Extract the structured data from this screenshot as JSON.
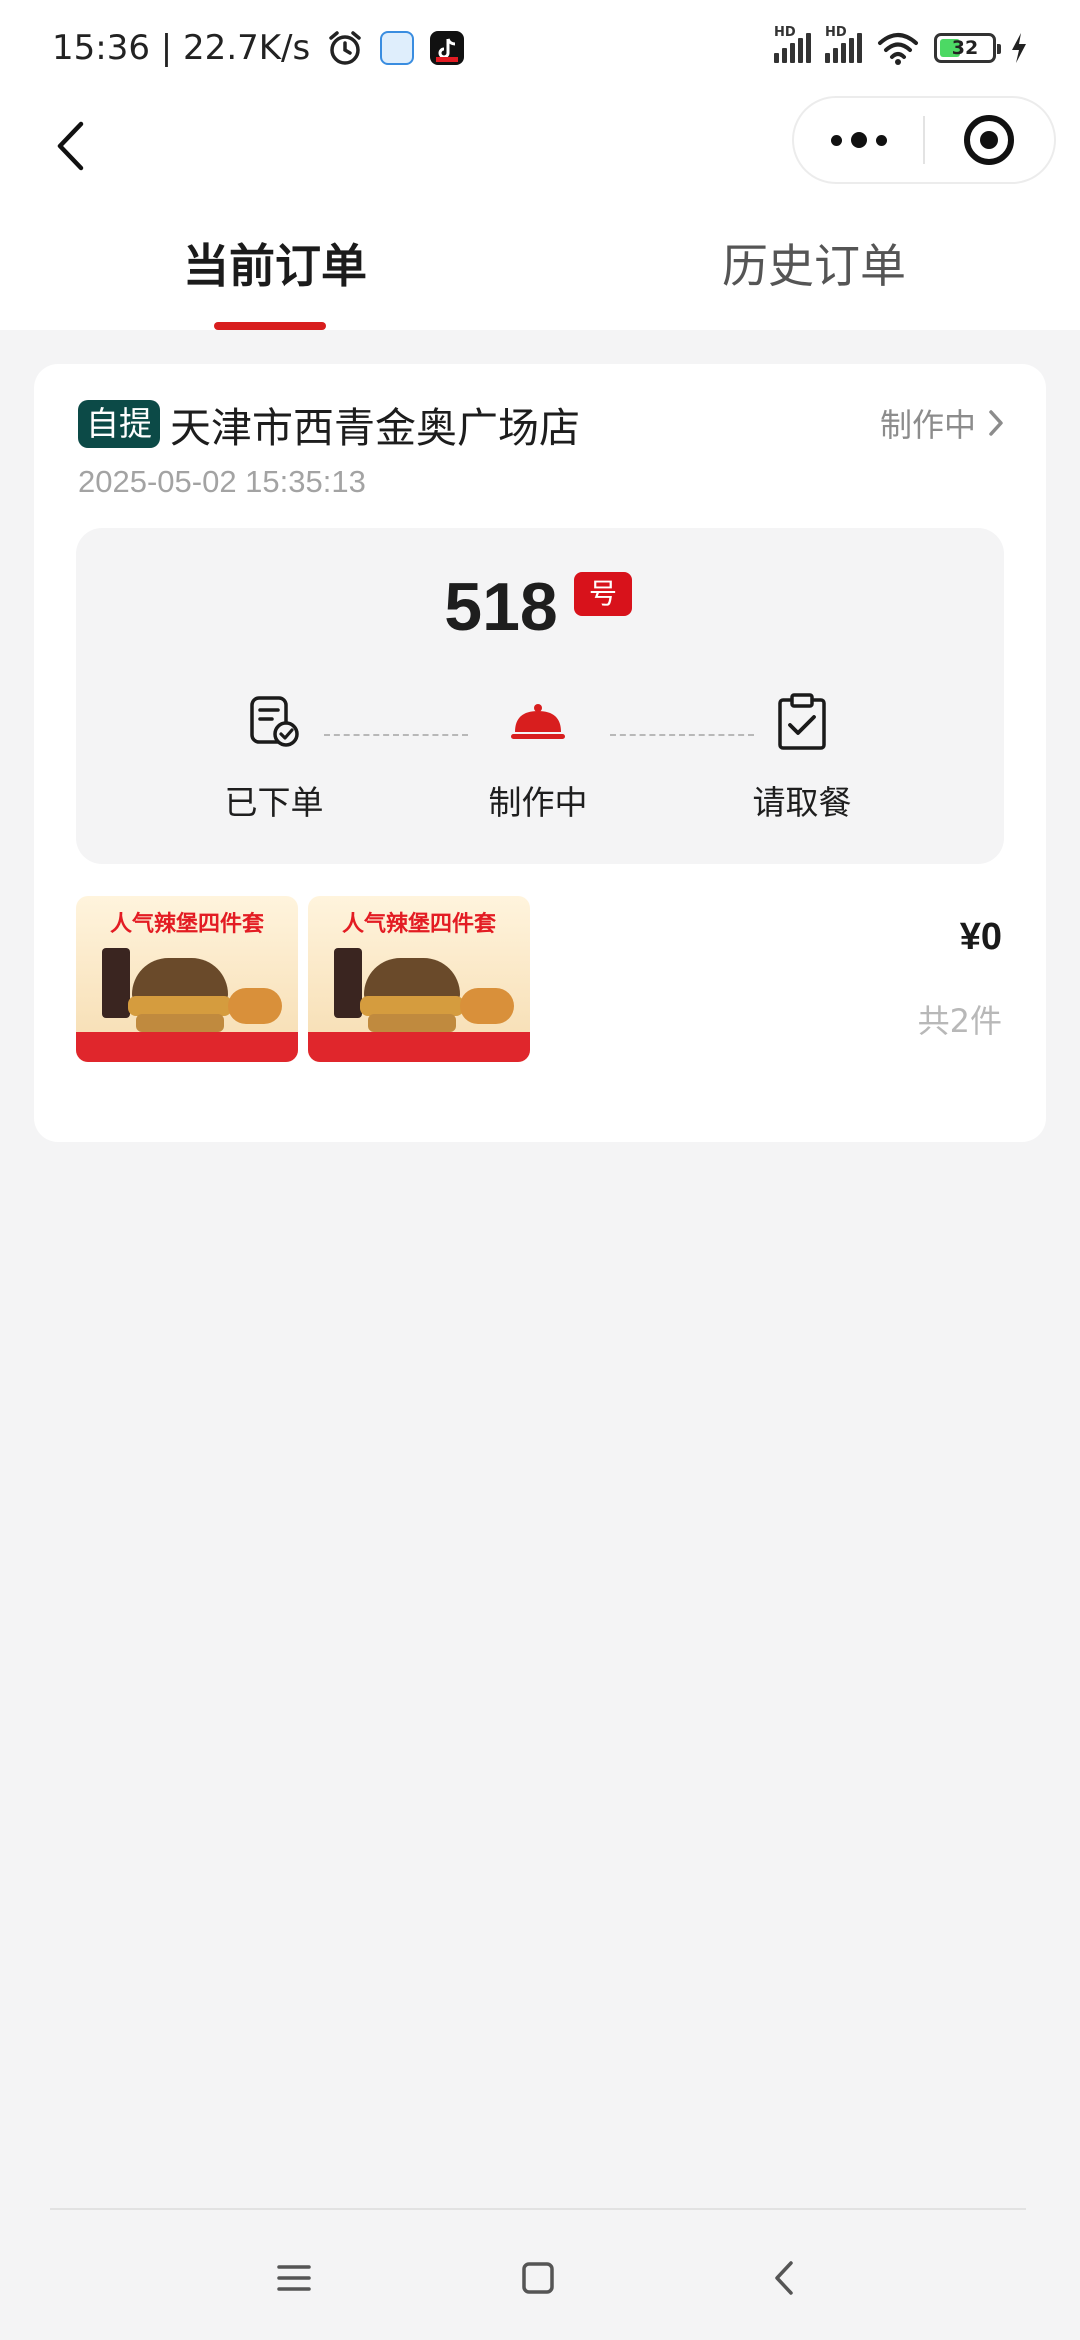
{
  "status_bar": {
    "time_speed": "15:36 | 22.7K/s",
    "network_label_1": "HD",
    "network_label_2": "HD",
    "battery": "32"
  },
  "nav": {
    "back_icon": "chevron-left-icon",
    "more_icon": "more-dots-icon",
    "close_icon": "target-circle-icon"
  },
  "tabs": [
    {
      "label": "当前订单",
      "active": true
    },
    {
      "label": "历史订单",
      "active": false
    }
  ],
  "order": {
    "tag": "自提",
    "store": "天津市西青金奥广场店",
    "status": "制作中",
    "time": "2025-05-02 15:35:13",
    "pickup_number": "518",
    "number_suffix": "号",
    "steps": [
      {
        "label": "已下单",
        "icon": "order-placed-icon"
      },
      {
        "label": "制作中",
        "icon": "cloche-icon"
      },
      {
        "label": "请取餐",
        "icon": "clipboard-check-icon"
      }
    ],
    "items": [
      {
        "name": "人气辣堡四件套"
      },
      {
        "name": "人气辣堡四件套"
      }
    ],
    "price": "¥0",
    "count": "共2件"
  },
  "colors": {
    "accent_red": "#d81e1e",
    "tag_green": "#0c4a47",
    "page_bg": "#f4f4f5"
  }
}
